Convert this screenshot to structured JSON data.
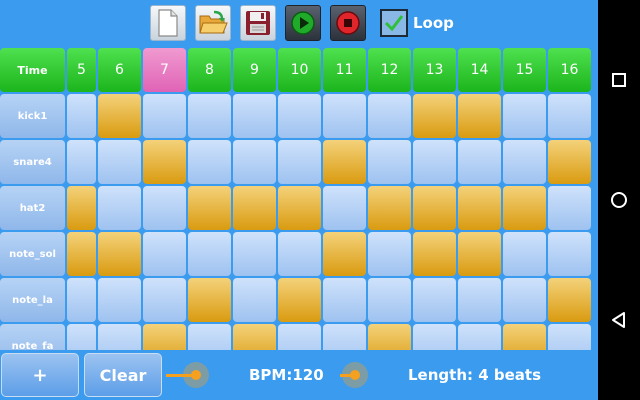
{
  "toolbar": {
    "loop_label": "Loop",
    "loop_checked": true,
    "play_color": "#1faa2a",
    "stop_color": "#e0262b"
  },
  "grid": {
    "time_label": "Time",
    "active_step": "7",
    "steps": [
      "5",
      "6",
      "7",
      "8",
      "9",
      "10",
      "11",
      "12",
      "13",
      "14",
      "15",
      "16"
    ],
    "rows": [
      {
        "label": "kick1",
        "pattern": [
          0,
          1,
          0,
          0,
          0,
          0,
          0,
          0,
          1,
          1,
          0,
          0
        ]
      },
      {
        "label": "snare4",
        "pattern": [
          0,
          0,
          1,
          0,
          0,
          0,
          1,
          0,
          0,
          0,
          0,
          1
        ]
      },
      {
        "label": "hat2",
        "pattern": [
          1,
          0,
          0,
          1,
          1,
          1,
          0,
          1,
          1,
          1,
          1,
          0
        ]
      },
      {
        "label": "note_sol",
        "pattern": [
          1,
          1,
          0,
          0,
          0,
          0,
          1,
          0,
          1,
          1,
          0,
          0
        ]
      },
      {
        "label": "note_la",
        "pattern": [
          0,
          0,
          0,
          1,
          0,
          1,
          0,
          0,
          0,
          0,
          0,
          1
        ]
      },
      {
        "label": "note_fa",
        "pattern": [
          0,
          0,
          1,
          0,
          1,
          0,
          0,
          1,
          0,
          0,
          1,
          0
        ]
      }
    ]
  },
  "bottombar": {
    "add_label": "+",
    "clear_label": "Clear",
    "bpm_label": "BPM:120",
    "length_label": "Length: 4 beats",
    "slider_color": "#f5a01e"
  }
}
